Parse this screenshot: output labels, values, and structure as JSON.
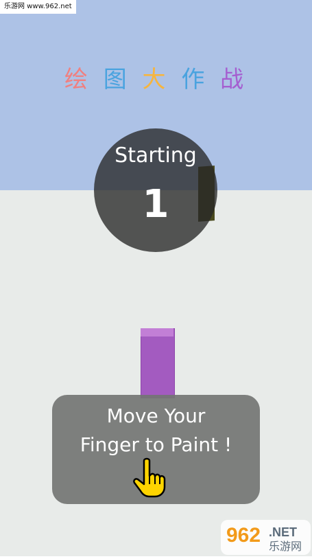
{
  "watermark": {
    "top": "乐游网 www.962.net",
    "bottom_logo": "962",
    "bottom_net": ".NET",
    "bottom_cn": "乐游网"
  },
  "title": {
    "chars": [
      "绘",
      "图",
      "大",
      "作",
      "战"
    ],
    "colors": [
      "#f08080",
      "#4aa3df",
      "#f6b53f",
      "#4aa3df",
      "#a55fd0"
    ]
  },
  "countdown": {
    "label": "Starting",
    "value": "1"
  },
  "instruction": {
    "line1": "Move Your",
    "line2": "Finger to Paint !"
  },
  "icons": {
    "hand": "pointing-hand-icon"
  },
  "colors": {
    "sky": "#adc2e6",
    "floor": "#e8ebe9",
    "cube": "#a35bc0",
    "post": "#4a4a1e"
  }
}
